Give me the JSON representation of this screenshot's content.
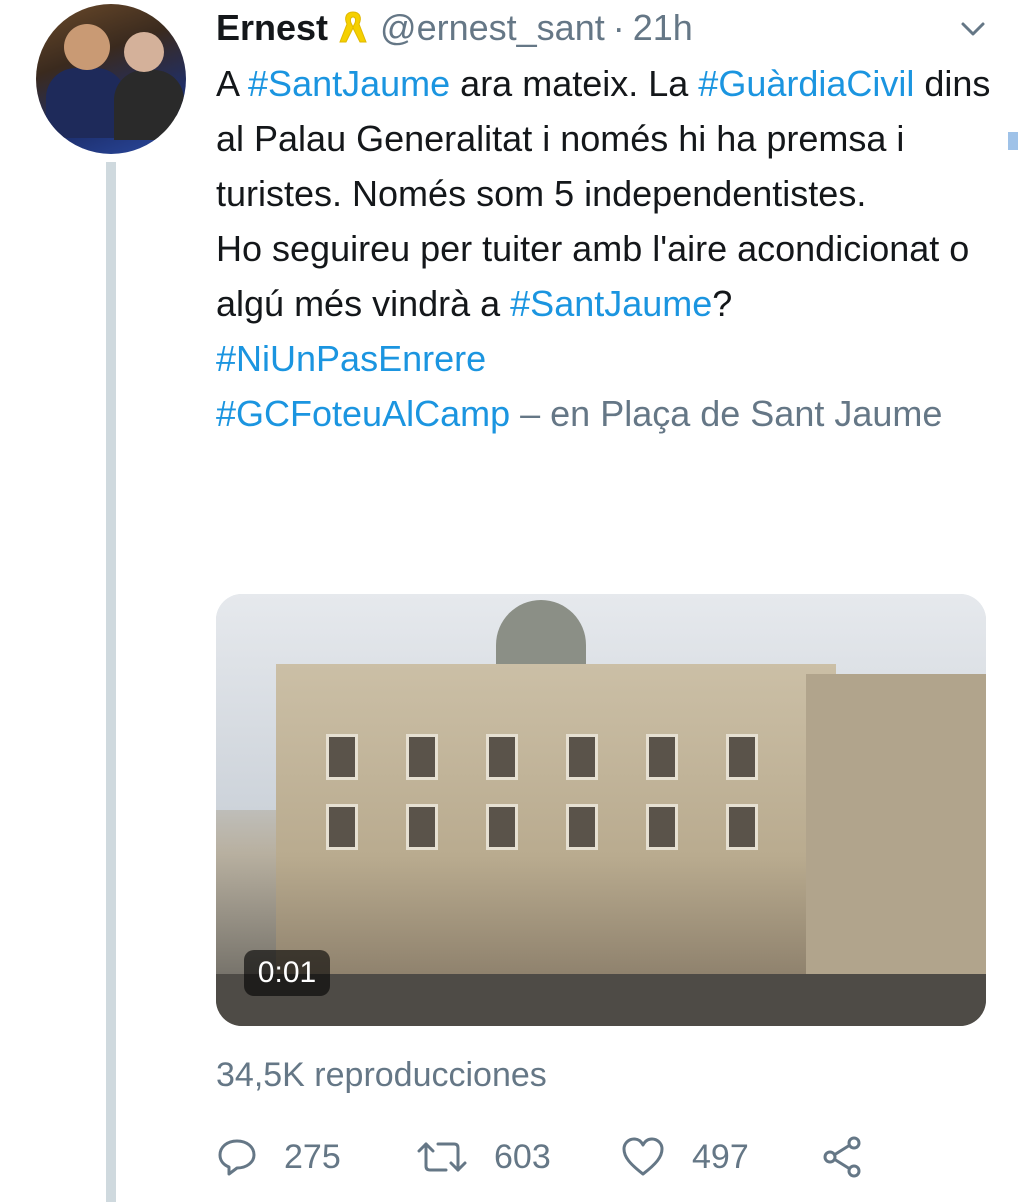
{
  "tweet": {
    "author_name": "Ernest",
    "handle": "@ernest_sant",
    "separator": "·",
    "time": "21h",
    "text_segments": [
      {
        "text": "A ",
        "type": "text"
      },
      {
        "text": "#SantJaume",
        "type": "hashtag"
      },
      {
        "text": " ara mateix. La ",
        "type": "text"
      },
      {
        "text": "#GuàrdiaCivil",
        "type": "hashtag"
      },
      {
        "text": " dins al Palau Generalitat i només hi ha premsa i turistes. Només som 5 independentistes.",
        "type": "text"
      },
      {
        "text": "Ho seguireu per tuiter amb l'aire acondicionat o algú més vindrà a ",
        "type": "text"
      },
      {
        "text": "#SantJaume",
        "type": "hashtag"
      },
      {
        "text": "? ",
        "type": "text"
      },
      {
        "text": "#NiUnPasEnrere",
        "type": "hashtag"
      },
      {
        "text": "#GCFoteuAlCamp",
        "type": "hashtag"
      },
      {
        "text": " – en Plaça de Sant Jaume",
        "type": "place"
      }
    ],
    "video_time": "0:01",
    "views": "34,5K reproducciones",
    "replies": "275",
    "retweets": "603",
    "likes": "497"
  },
  "icons": {
    "ribbon": "yellow-ribbon-icon",
    "menu": "chevron-down-icon",
    "reply": "reply-icon",
    "retweet": "retweet-icon",
    "like": "heart-icon",
    "share": "share-icon"
  },
  "colors": {
    "hashtag": "#1b95e0",
    "muted": "#657786",
    "text": "#14171a",
    "ribbon": "#f5d000",
    "thread_line": "#cfd9de"
  }
}
